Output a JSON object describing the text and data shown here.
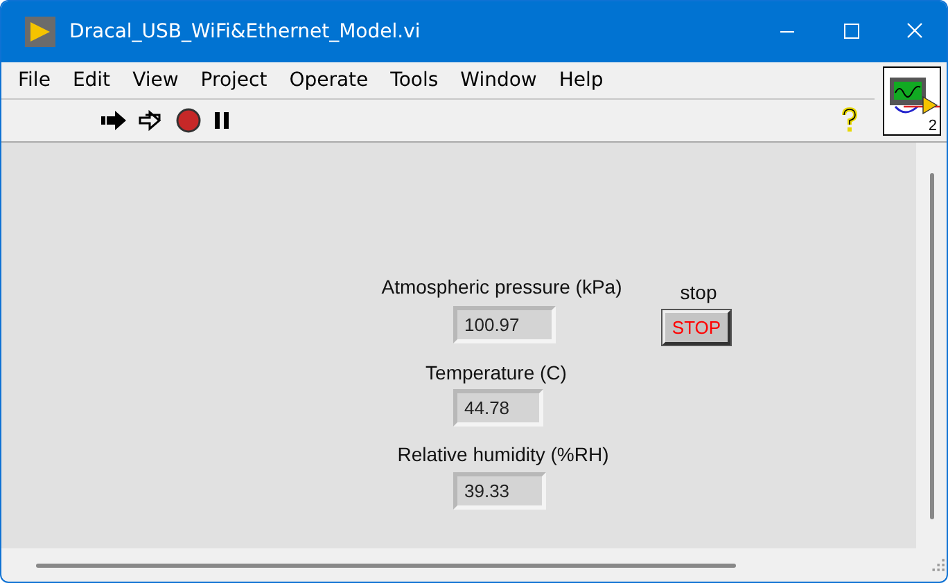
{
  "window": {
    "title": "Dracal_USB_WiFi&Ethernet_Model.vi"
  },
  "menu": [
    "File",
    "Edit",
    "View",
    "Project",
    "Operate",
    "Tools",
    "Window",
    "Help"
  ],
  "indicators": [
    {
      "label": "Atmospheric pressure (kPa)",
      "value": "100.97"
    },
    {
      "label": "Temperature (C)",
      "value": "44.78"
    },
    {
      "label": "Relative humidity (%RH)",
      "value": "39.33"
    }
  ],
  "stop": {
    "label": "stop",
    "text": "STOP"
  },
  "connector_pane": {
    "number": "2"
  }
}
